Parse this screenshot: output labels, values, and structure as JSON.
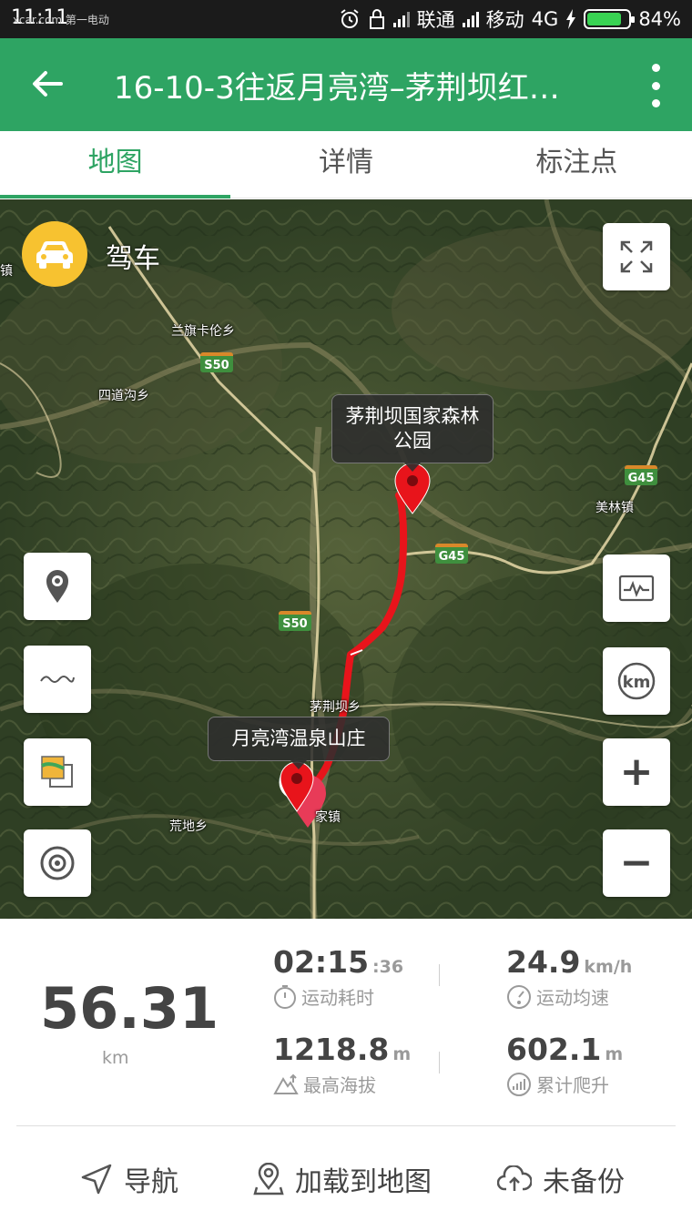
{
  "status_bar": {
    "time": "11:11",
    "watermark": "xcar.com 第一电动",
    "carrier1": "联通",
    "carrier2": "移动",
    "network": "4G",
    "battery": "84%",
    "battery_level": 0.84,
    "battery_color": "#39d353"
  },
  "app_bar": {
    "title": "16-10-3往返月亮湾–茅荆坝红…",
    "back_icon": "arrow-left-icon",
    "menu_icon": "more-vert-icon",
    "color": "#2ea463"
  },
  "tabs": [
    {
      "label": "地图",
      "active": true
    },
    {
      "label": "详情",
      "active": false
    },
    {
      "label": "标注点",
      "active": false
    }
  ],
  "map": {
    "mode_label": "驾车",
    "mode_icon": "car-icon",
    "place_labels": {
      "lanqika": "兰旗卡伦乡",
      "sidaogou": "四道沟乡",
      "meilin": "美林镇",
      "maojingba": "茅荆坝乡",
      "huangdi": "荒地乡",
      "zhen_partial": "家镇",
      "left_edge": "家镇"
    },
    "road_badges": {
      "s50_top": "S50",
      "s50_mid": "S50",
      "g45_right": "G45",
      "g45_mid": "G45"
    },
    "callouts": {
      "end": "茅荆坝国家森林\n公园",
      "start": "月亮湾温泉山庄"
    },
    "controls": {
      "fullscreen_icon": "fullscreen-icon",
      "marker_icon": "location-pin-icon",
      "wave_icon": "route-wave-icon",
      "layer_icon": "map-layers-icon",
      "locate_icon": "target-locate-icon",
      "chart_icon": "elevation-chart-icon",
      "km_icon": "km-marker-icon",
      "zoom_in": "+",
      "zoom_out": "−"
    },
    "route_color": "#e8141b"
  },
  "stats": {
    "distance": "56.31",
    "distance_unit": "km",
    "duration_main": "02:15",
    "duration_seconds": ":36",
    "duration_label": "运动耗时",
    "avg_speed": "24.9",
    "avg_speed_unit": "km/h",
    "avg_speed_label": "运动均速",
    "max_altitude": "1218.8",
    "max_altitude_unit": "m",
    "max_altitude_label": "最高海拔",
    "total_climb": "602.1",
    "total_climb_unit": "m",
    "total_climb_label": "累计爬升"
  },
  "actions": {
    "navigate": "导航",
    "load_to_map": "加载到地图",
    "backup": "未备份"
  }
}
